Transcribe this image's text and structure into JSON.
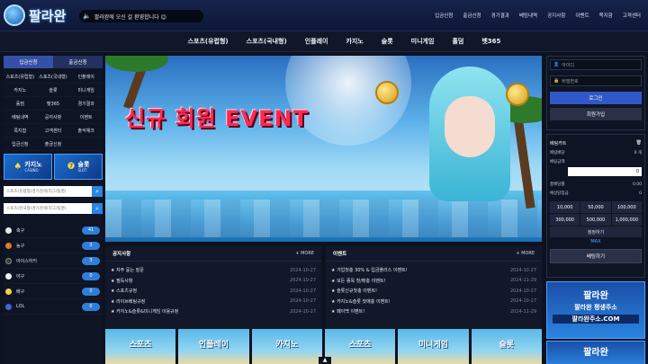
{
  "header": {
    "logo_text": "팔라완",
    "notice": "팔라완에 오신 걸 환영합니다 😊",
    "nav": [
      "입금신청",
      "출금신청",
      "경기결과",
      "베팅내역",
      "공지사항",
      "이벤트",
      "쪽지함",
      "고객센터"
    ]
  },
  "main_nav": [
    "스포츠(유럽형)",
    "스포츠(국내형)",
    "인플레이",
    "카지노",
    "슬롯",
    "미니게임",
    "홀덤",
    "벳365"
  ],
  "left": {
    "tab_deposit": "입금신청",
    "tab_withdraw": "출금신청",
    "grid": [
      "스포츠(유럽형)",
      "스포츠(국내형)",
      "인플레이",
      "카지노",
      "슬롯",
      "미니게임",
      "홀덤",
      "벳365",
      "경기결과",
      "베팅내역",
      "공지사항",
      "이벤트",
      "쪽지함",
      "고객센터",
      "출석체크",
      "입금신청",
      "출금신청",
      ""
    ],
    "casino": {
      "title": "카지노",
      "sub": "CASINO"
    },
    "slot": {
      "title": "슬롯",
      "sub": "SLOT"
    },
    "search1_placeholder": "스포츠(유럽형)경기검색(리그/팀명)",
    "search2_placeholder": "스포츠(한국형)경기검색(리그/팀명)",
    "sports": [
      {
        "name": "축구",
        "count": "41",
        "color": "#e8e8e8"
      },
      {
        "name": "농구",
        "count": "3",
        "color": "#e07a2a"
      },
      {
        "name": "아이스하키",
        "count": "3",
        "color": "#3a3a3a"
      },
      {
        "name": "야구",
        "count": "0",
        "color": "#f0f0f0"
      },
      {
        "name": "배구",
        "count": "0",
        "color": "#f2d24a"
      },
      {
        "name": "LOL",
        "count": "0",
        "color": "#3a6ad0"
      }
    ]
  },
  "banner": {
    "event_text": "신규 회원 EVENT"
  },
  "right": {
    "id_placeholder": "아이디",
    "pw_placeholder": "비밀번호",
    "login": "로그인",
    "join": "회원가입",
    "cart_title": "베팅카트",
    "trash_icon": "trash-icon",
    "rows": [
      {
        "label": "베팅배당",
        "value": "0 개"
      },
      {
        "label": "베팅금액",
        "value": ""
      }
    ],
    "amount": "0",
    "rows2": [
      {
        "label": "총배당률",
        "value": "0.00"
      },
      {
        "label": "예상당첨금",
        "value": "0"
      }
    ],
    "chips": [
      "10,000",
      "50,000",
      "100,000",
      "300,000",
      "500,000",
      "1,000,000"
    ],
    "reset": "정정하기",
    "max": "MAX",
    "bet": "배팅하기",
    "ad": {
      "l1": "팔라완",
      "l2": "팔라완 평생주소",
      "l3": "팔라완주소.COM"
    },
    "ad2": {
      "l1": "팔라완"
    }
  },
  "notice_board": {
    "title": "공지사항",
    "more": "+ MORE",
    "items": [
      {
        "title": "★ 자주 묻는 질문",
        "date": "2024-10-27"
      },
      {
        "title": "★ 필독사항",
        "date": "2024-10-27"
      },
      {
        "title": "★ 스포츠규정",
        "date": "2024-10-27"
      },
      {
        "title": "★ 라이브베팅규정",
        "date": "2024-10-27"
      },
      {
        "title": "★ 카지노&슬롯&미니게임 이용규정",
        "date": "2024-10-27"
      }
    ]
  },
  "event_board": {
    "title": "이벤트",
    "more": "+ MORE",
    "items": [
      {
        "title": "★ 가입첫충 30% & 입금플러스 이벤트!",
        "date": "2024-10-27"
      },
      {
        "title": "★ 모든 종목 첫/매충 이벤트!",
        "date": "2024-11-29"
      },
      {
        "title": "★ 슬롯신규첫충 이벤트!",
        "date": "2024-10-27"
      },
      {
        "title": "★ 카지노&슬롯 첫매충 이벤트!",
        "date": "2024-10-27"
      },
      {
        "title": "★ 페이백 이벤트!",
        "date": "2024-11-29"
      }
    ]
  },
  "thumbnails": [
    "스포츠",
    "인플레이",
    "카지노",
    "스포츠",
    "미니게임",
    "슬롯"
  ]
}
